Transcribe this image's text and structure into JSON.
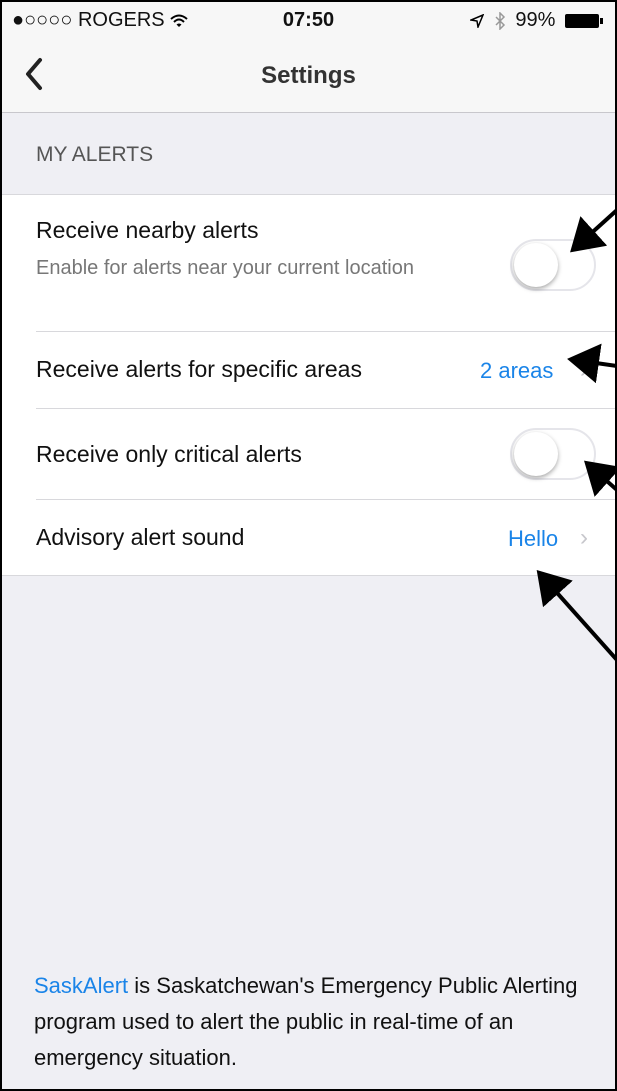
{
  "status": {
    "carrier": "●○○○○ ROGERS",
    "time": "07:50",
    "battery": "99%"
  },
  "nav": {
    "title": "Settings"
  },
  "section": {
    "header": "MY ALERTS"
  },
  "rows": {
    "nearby": {
      "label": "Receive nearby alerts",
      "sub": "Enable for alerts near your current location",
      "toggle_on": false
    },
    "areas": {
      "label": "Receive alerts for specific areas",
      "value": "2 areas"
    },
    "critical": {
      "label": "Receive only critical alerts",
      "toggle_on": false
    },
    "sound": {
      "label": "Advisory alert sound",
      "value": "Hello"
    }
  },
  "footer": {
    "link": "SaskAlert",
    "text": " is Saskatchewan's Emergency Public Alerting program used to alert the public in real-time of an emergency situation."
  },
  "colors": {
    "accent": "#1a84e8",
    "background": "#efeff4"
  }
}
